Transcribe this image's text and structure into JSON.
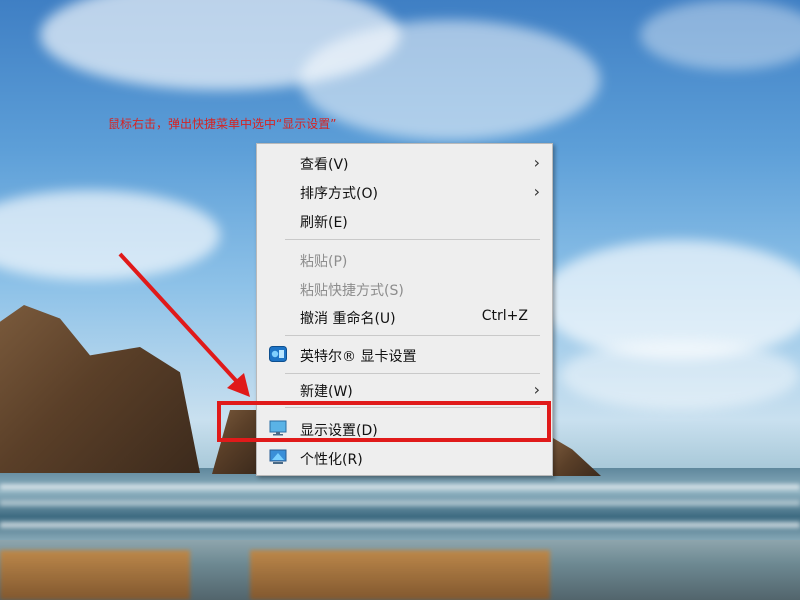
{
  "annotation": {
    "instruction_text": "鼠标右击，弹出快捷菜单中选中“显示设置”",
    "color": "#d42424"
  },
  "context_menu": {
    "items": [
      {
        "label": "查看(V)",
        "has_submenu": true,
        "enabled": true
      },
      {
        "label": "排序方式(O)",
        "has_submenu": true,
        "enabled": true
      },
      {
        "label": "刷新(E)",
        "has_submenu": false,
        "enabled": true
      },
      {
        "label": "粘贴(P)",
        "has_submenu": false,
        "enabled": false
      },
      {
        "label": "粘贴快捷方式(S)",
        "has_submenu": false,
        "enabled": false
      },
      {
        "label": "撤消 重命名(U)",
        "shortcut": "Ctrl+Z",
        "has_submenu": false,
        "enabled": true
      },
      {
        "label": "英特尔® 显卡设置",
        "icon": "intel-graphics-icon",
        "has_submenu": false,
        "enabled": true
      },
      {
        "label": "新建(W)",
        "has_submenu": true,
        "enabled": true
      },
      {
        "label": "显示设置(D)",
        "icon": "display-settings-icon",
        "has_submenu": false,
        "enabled": true,
        "highlighted": true
      },
      {
        "label": "个性化(R)",
        "icon": "personalize-icon",
        "has_submenu": false,
        "enabled": true
      }
    ],
    "submenu_glyph": "›"
  },
  "colors": {
    "highlight_box": "#e01a1a",
    "arrow": "#e01a1a",
    "menu_background": "#eeeeee",
    "disabled_text": "#8d8d8d"
  }
}
